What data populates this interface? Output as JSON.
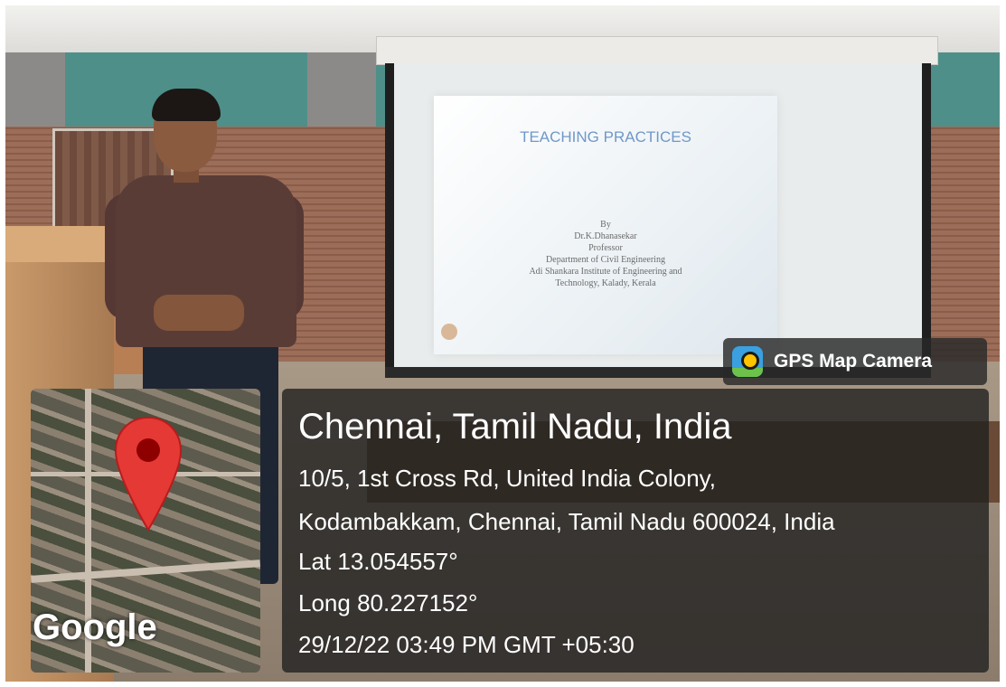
{
  "slide": {
    "title": "TEACHING PRACTICES",
    "lines": [
      "By",
      "Dr.K.Dhanasekar",
      "Professor",
      "Department of Civil Engineering",
      "Adi Shankara Institute of Engineering and",
      "Technology, Kalady, Kerala"
    ]
  },
  "gps_badge": {
    "label": "GPS Map Camera",
    "icon": "gps-map-camera-icon"
  },
  "map": {
    "logo": "Google",
    "pin_icon": "location-pin-icon",
    "pin_color": "#e53935"
  },
  "location": {
    "city": "Chennai, Tamil Nadu, India",
    "address_line1": "10/5, 1st Cross Rd, United India Colony,",
    "address_line2": "Kodambakkam, Chennai, Tamil Nadu 600024, India",
    "lat": "Lat 13.054557°",
    "long": "Long 80.227152°",
    "timestamp": "29/12/22 03:49 PM GMT +05:30"
  }
}
